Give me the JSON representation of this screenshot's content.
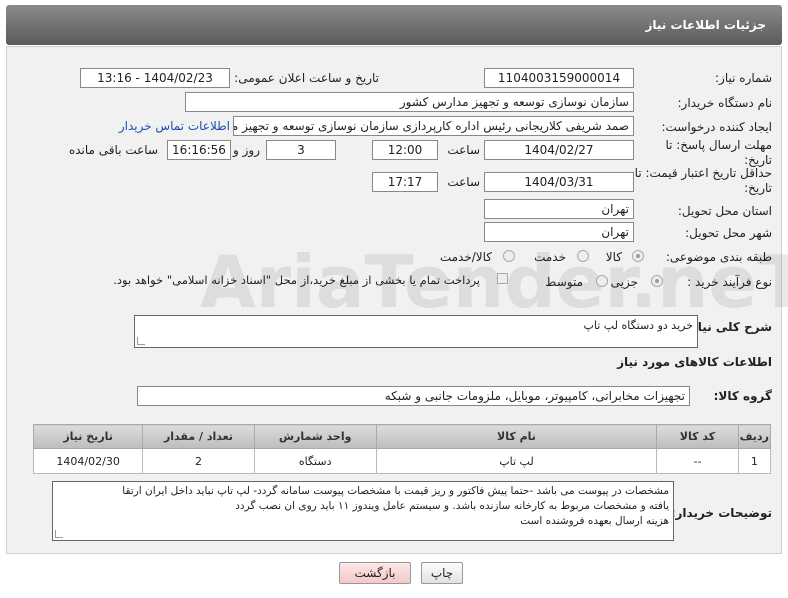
{
  "header": {
    "title": "جزئیات اطلاعات نیاز"
  },
  "form": {
    "need_number": {
      "label": "شماره نیاز:",
      "value": "1104003159000014"
    },
    "announce_datetime": {
      "label": "تاریخ و ساعت اعلان عمومی:",
      "value": "1404/02/23 - 13:16"
    },
    "buyer_org": {
      "label": "نام دستگاه خریدار:",
      "value": "سازمان نوسازی  توسعه و تجهیز مدارس کشور"
    },
    "requester": {
      "label": "ایجاد کننده درخواست:",
      "value": "صمد شریفی کلاریجانی رئیس اداره کارپردازی سازمان نوسازی  توسعه و تجهیز مدارس",
      "contact_link": "اطلاعات تماس خریدار"
    },
    "reply_deadline": {
      "label": "مهلت ارسال پاسخ: تا تاریخ:",
      "date": "1404/02/27",
      "time_label": "ساعت",
      "time": "12:00",
      "days": "3",
      "days_label": "روز و",
      "remaining": "16:16:56",
      "remaining_label": "ساعت باقی مانده"
    },
    "price_validity": {
      "label": "حداقل تاریخ اعتبار قیمت: تا تاریخ:",
      "date": "1404/03/31",
      "time_label": "ساعت",
      "time": "17:17"
    },
    "delivery_province": {
      "label": "استان محل تحویل:",
      "value": "تهران"
    },
    "delivery_city": {
      "label": "شهر محل تحویل:",
      "value": "تهران"
    },
    "category": {
      "label": "طبقه بندی موضوعی:",
      "options": [
        "کالا",
        "خدمت",
        "کالا/خدمت"
      ],
      "selected": "کالا"
    },
    "process_type": {
      "label": "نوع فرآیند خرید :",
      "options": [
        "جزیی",
        "متوسط"
      ],
      "selected": "جزیی",
      "payment_note": "پرداخت تمام یا بخشی از مبلغ خرید،از محل \"اسناد خزانه اسلامی\" خواهد بود."
    }
  },
  "description": {
    "label": "شرح کلی نیاز:",
    "value": "خرید دو دستگاه لپ تاپ"
  },
  "goods_section": {
    "title": "اطلاعات کالاهای مورد نیاز",
    "group_label": "گروه کالا:",
    "group_value": "تجهیزات مخابراتی، کامپیوتر، موبایل، ملزومات جانبی و شبکه"
  },
  "table": {
    "headers": [
      "ردیف",
      "کد کالا",
      "نام کالا",
      "واحد شمارش",
      "تعداد / مقدار",
      "تاریخ نیاز"
    ],
    "rows": [
      [
        "1",
        "--",
        "لپ تاپ",
        "دستگاه",
        "2",
        "1404/02/30"
      ]
    ]
  },
  "buyer_notes": {
    "label": "توضیحات خریدار:",
    "lines": [
      "مشخصات در پیوست می باشد -حتما پیش فاکتور و ریز قیمت با مشخصات پیوست سامانه گردد- لپ تاپ نباید داخل ایران ارتقا",
      "یافته و مشخصات مربوط به کارخانه سازنده باشد. و سیستم عامل ویندوز ۱۱ باید روی ان نصب گردد",
      "هزینه ارسال بعهده فروشنده است"
    ]
  },
  "buttons": {
    "print": "چاپ",
    "back": "بازگشت"
  },
  "watermark": "AriaTender.neT"
}
